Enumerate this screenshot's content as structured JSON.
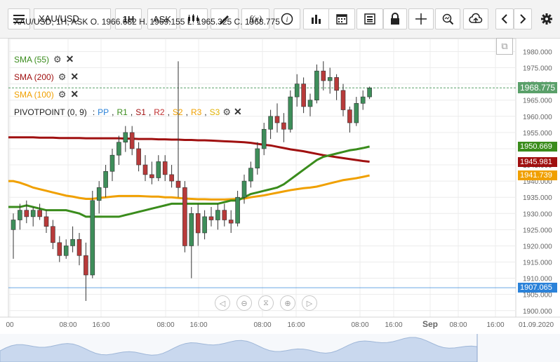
{
  "toolbar": {
    "symbol": "XAU/USD",
    "timeframe": "1H",
    "price_side": "ASK",
    "buttons": [
      "menu-icon",
      "candles-icon",
      "pencil-icon",
      "fx-icon",
      "info-icon",
      "bars-icon",
      "calendar-icon",
      "list-icon",
      "lock-icon",
      "crosshair-icon",
      "zoom-icon",
      "cloud-upload-icon",
      "chevron-left-icon",
      "chevron-right-icon",
      "gear-icon"
    ]
  },
  "header": {
    "info_line": "XAU/USD, 1H, ASK   O. 1966.682  H. 1969.155  L. 1965.325  C. 1968.775"
  },
  "indicators": [
    {
      "label": "SMA (55)",
      "color": "#3a8c1c"
    },
    {
      "label": "SMA (200)",
      "color": "#a01010"
    },
    {
      "label": "SMA (100)",
      "color": "#f0a000"
    }
  ],
  "pivot": {
    "label": "PIVOTPOINT (0, 9)",
    "parts": [
      {
        "text": "PP",
        "color": "#2b82d9"
      },
      {
        "text": "R1",
        "color": "#3a8c1c"
      },
      {
        "text": "S1",
        "color": "#a01010"
      },
      {
        "text": "R2",
        "color": "#c03030"
      },
      {
        "text": "S2",
        "color": "#f0a000"
      },
      {
        "text": "R3",
        "color": "#f0a000"
      },
      {
        "text": "S3",
        "color": "#e0b000"
      }
    ]
  },
  "price_axis": {
    "ticks": [
      "1980.000",
      "1975.000",
      "1970.000",
      "1965.000",
      "1960.000",
      "1955.000",
      "1950.000",
      "1945.000",
      "1940.000",
      "1935.000",
      "1930.000",
      "1925.000",
      "1920.000",
      "1915.000",
      "1910.000",
      "1905.000",
      "1900.000"
    ],
    "labels": [
      {
        "text": "1968.775",
        "color": "#5aa06a",
        "value": 1968.775
      },
      {
        "text": "1950.669",
        "color": "#3a8c1c",
        "value": 1950.669
      },
      {
        "text": "1945.981",
        "color": "#a01010",
        "value": 1945.981
      },
      {
        "text": "1941.739",
        "color": "#f0a000",
        "value": 1941.739
      },
      {
        "text": "1907.065",
        "color": "#2b82d9",
        "value": 1907.065
      }
    ]
  },
  "time_axis": {
    "labels": [
      "00",
      "08:00",
      "16:00",
      "08:00",
      "16:00",
      "08:00",
      "16:00",
      "08:00",
      "16:00",
      "Sep",
      "08:00",
      "16:00",
      "01.09.2020"
    ]
  },
  "chart_data": {
    "type": "candlestick",
    "symbol": "XAU/USD",
    "ylim": [
      1898,
      1984
    ],
    "candles": [
      [
        1925,
        1930,
        1916,
        1928
      ],
      [
        1928,
        1933,
        1925,
        1931
      ],
      [
        1931,
        1934,
        1927,
        1929
      ],
      [
        1929,
        1932,
        1926,
        1931
      ],
      [
        1931,
        1933,
        1928,
        1929
      ],
      [
        1929,
        1931,
        1924,
        1926
      ],
      [
        1926,
        1928,
        1919,
        1921
      ],
      [
        1921,
        1923,
        1915,
        1917
      ],
      [
        1917,
        1922,
        1916,
        1920
      ],
      [
        1920,
        1926,
        1918,
        1922
      ],
      [
        1922,
        1924,
        1914,
        1917
      ],
      [
        1917,
        1921,
        1903,
        1911
      ],
      [
        1911,
        1937,
        1910,
        1934
      ],
      [
        1934,
        1940,
        1930,
        1938
      ],
      [
        1938,
        1945,
        1935,
        1943
      ],
      [
        1943,
        1950,
        1940,
        1948
      ],
      [
        1948,
        1954,
        1945,
        1952
      ],
      [
        1952,
        1957,
        1949,
        1955
      ],
      [
        1955,
        1957,
        1948,
        1950
      ],
      [
        1950,
        1952,
        1943,
        1945
      ],
      [
        1945,
        1948,
        1940,
        1942
      ],
      [
        1942,
        1946,
        1939,
        1941
      ],
      [
        1941,
        1948,
        1940,
        1946
      ],
      [
        1946,
        1948,
        1940,
        1942
      ],
      [
        1942,
        1945,
        1938,
        1940
      ],
      [
        1940,
        1977,
        1935,
        1938
      ],
      [
        1938,
        1940,
        1918,
        1920
      ],
      [
        1920,
        1932,
        1910,
        1930
      ],
      [
        1930,
        1933,
        1920,
        1924
      ],
      [
        1924,
        1931,
        1922,
        1929
      ],
      [
        1929,
        1932,
        1926,
        1928
      ],
      [
        1928,
        1933,
        1925,
        1931
      ],
      [
        1931,
        1933,
        1926,
        1928
      ],
      [
        1928,
        1931,
        1924,
        1927
      ],
      [
        1927,
        1937,
        1926,
        1935
      ],
      [
        1935,
        1942,
        1933,
        1940
      ],
      [
        1940,
        1946,
        1938,
        1944
      ],
      [
        1944,
        1952,
        1942,
        1950
      ],
      [
        1950,
        1958,
        1948,
        1956
      ],
      [
        1956,
        1962,
        1953,
        1960
      ],
      [
        1960,
        1964,
        1955,
        1958
      ],
      [
        1958,
        1961,
        1952,
        1956
      ],
      [
        1956,
        1968,
        1955,
        1966
      ],
      [
        1966,
        1973,
        1963,
        1970
      ],
      [
        1970,
        1972,
        1961,
        1963
      ],
      [
        1963,
        1967,
        1960,
        1965
      ],
      [
        1965,
        1976,
        1964,
        1974
      ],
      [
        1974,
        1977,
        1968,
        1971
      ],
      [
        1971,
        1975,
        1967,
        1972
      ],
      [
        1972,
        1973,
        1965,
        1968
      ],
      [
        1968,
        1970,
        1960,
        1962
      ],
      [
        1962,
        1963,
        1955,
        1958
      ],
      [
        1958,
        1966,
        1957,
        1964
      ],
      [
        1964,
        1968,
        1962,
        1966
      ],
      [
        1966,
        1969.155,
        1965.325,
        1968.775
      ]
    ],
    "sma55": [
      1932,
      1932,
      1932.5,
      1932,
      1931.5,
      1931,
      1931,
      1931,
      1931,
      1930.5,
      1930,
      1929,
      1929,
      1929,
      1929,
      1929,
      1929,
      1929.5,
      1930,
      1930.5,
      1931,
      1931.5,
      1932,
      1932.5,
      1933,
      1933,
      1933,
      1933,
      1933,
      1933,
      1933,
      1933,
      1933.5,
      1934,
      1934,
      1935,
      1936,
      1936.5,
      1937,
      1937.5,
      1938,
      1939,
      1940.5,
      1942,
      1943.5,
      1945,
      1946.5,
      1947.5,
      1948,
      1948.5,
      1949,
      1949.5,
      1949.8,
      1950.2,
      1950.669
    ],
    "sma200": [
      1953.5,
      1953.5,
      1953.5,
      1953.5,
      1953.4,
      1953.4,
      1953.4,
      1953.3,
      1953.3,
      1953.3,
      1953.3,
      1953.2,
      1953.2,
      1953.2,
      1953.2,
      1953.2,
      1953.2,
      1953.1,
      1953.1,
      1953,
      1953,
      1953,
      1952.9,
      1952.9,
      1952.8,
      1952.8,
      1952.7,
      1952.7,
      1952.6,
      1952.6,
      1952.5,
      1952.4,
      1952.3,
      1952.2,
      1952.1,
      1952,
      1951.8,
      1951.5,
      1951.2,
      1951,
      1950.6,
      1950.2,
      1949.8,
      1949.5,
      1949.2,
      1948.8,
      1948.4,
      1948,
      1947.7,
      1947.4,
      1947.1,
      1946.8,
      1946.5,
      1946.2,
      1945.981
    ],
    "sma100": [
      1940,
      1939.5,
      1938.8,
      1938,
      1937.5,
      1937,
      1936.5,
      1936,
      1935.5,
      1935.2,
      1934.8,
      1934.5,
      1934.5,
      1934.8,
      1935,
      1935.2,
      1935.4,
      1935.4,
      1935.4,
      1935.4,
      1935.3,
      1935.2,
      1935.2,
      1935,
      1935,
      1934.8,
      1934.6,
      1934.5,
      1934.4,
      1934.4,
      1934.3,
      1934.3,
      1934.3,
      1934.4,
      1934.5,
      1934.6,
      1935,
      1935.3,
      1935.6,
      1936,
      1936.4,
      1936.8,
      1937.2,
      1937.5,
      1937.8,
      1938,
      1938.3,
      1938.8,
      1939.3,
      1939.8,
      1940.3,
      1940.6,
      1940.9,
      1941.3,
      1941.739
    ]
  }
}
